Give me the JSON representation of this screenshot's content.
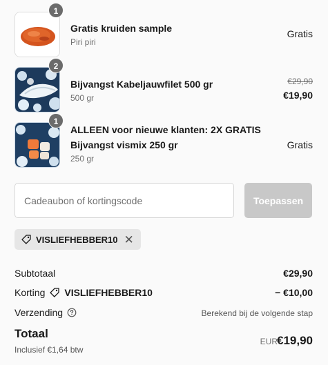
{
  "items": [
    {
      "qty": "1",
      "title_lines": [
        "Gratis kruiden sample"
      ],
      "variant": "Piri piri",
      "price": "Gratis",
      "thumb_icon": "spice-powder-image"
    },
    {
      "qty": "2",
      "title_lines": [
        "Bijvangst Kabeljauwfilet 500 gr"
      ],
      "variant": "500 gr",
      "original_price": "€29,90",
      "price": "€19,90",
      "thumb_icon": "cod-fillet-on-ice-image"
    },
    {
      "qty": "1",
      "title_lines": [
        "ALLEEN voor nieuwe klanten: 2X GRATIS",
        "Bijvangst vismix 250 gr"
      ],
      "variant": "250 gr",
      "price": "Gratis",
      "thumb_icon": "fish-mix-on-ice-image"
    }
  ],
  "discount": {
    "placeholder": "Cadeaubon of kortingscode",
    "apply_label": "Toepassen",
    "applied_code": "VISLIEFHEBBER10"
  },
  "summary": {
    "subtotal_label": "Subtotaal",
    "subtotal_value": "€29,90",
    "discount_label": "Korting",
    "discount_code": "VISLIEFHEBBER10",
    "discount_value": "− €10,00",
    "shipping_label": "Verzending",
    "shipping_value": "Berekend bij de volgende stap",
    "total_label": "Totaal",
    "tax_note": "Inclusief €1,64 btw",
    "currency": "EUR",
    "total_value": "€19,90"
  },
  "colors": {
    "badge": "#6b6b6b",
    "chip_bg": "#e6e6e6",
    "button_disabled": "#c8c8c8"
  }
}
